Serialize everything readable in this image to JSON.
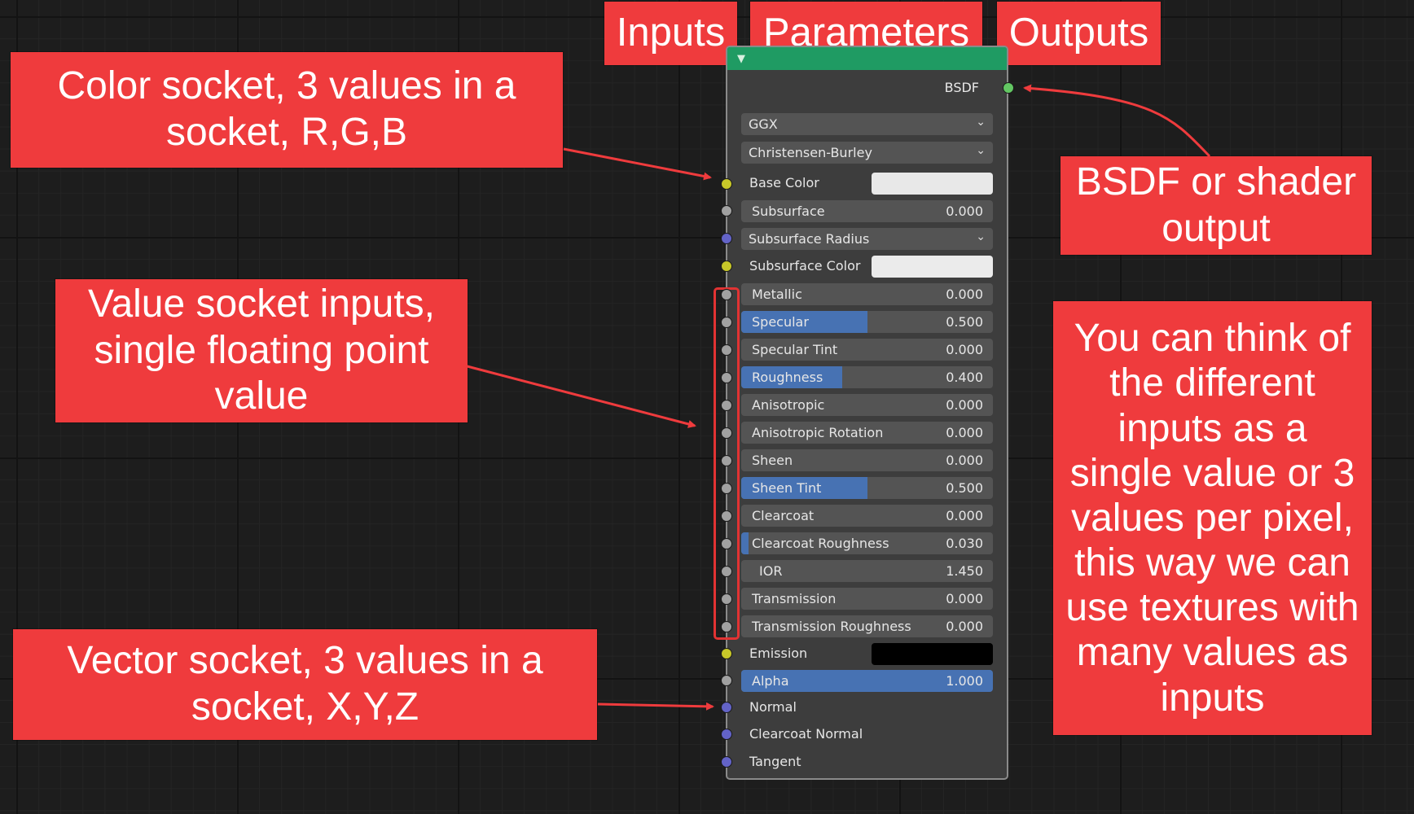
{
  "callouts": {
    "inputs": "Inputs",
    "parameters": "Parameters",
    "outputs": "Outputs",
    "color_socket": "Color socket, 3 values in a\nsocket, R,G,B",
    "bsdf_output": "BSDF or shader\noutput",
    "value_socket": "Value socket inputs,\nsingle floating point\nvalue",
    "textures_note": "You can think of\nthe different\ninputs as a\nsingle value or 3\nvalues per pixel,\nthis way we can\nuse textures with\nmany values as\ninputs",
    "vector_socket": "Vector socket, 3 values in a\nsocket, X,Y,Z"
  },
  "node": {
    "output_label": "BSDF",
    "distribution": "GGX",
    "subsurface_method": "Christensen-Burley",
    "base_color_label": "Base Color",
    "base_color": "#e8e8e8",
    "subsurface_radius_label": "Subsurface Radius",
    "subsurface_color_label": "Subsurface Color",
    "subsurface_color": "#ebebeb",
    "emission_label": "Emission",
    "emission_color": "#000000",
    "fields": [
      {
        "label": "Subsurface",
        "value": "0.000",
        "fill": 0.0
      },
      {
        "label": "Metallic",
        "value": "0.000",
        "fill": 0.0
      },
      {
        "label": "Specular",
        "value": "0.500",
        "fill": 0.5
      },
      {
        "label": "Specular Tint",
        "value": "0.000",
        "fill": 0.0
      },
      {
        "label": "Roughness",
        "value": "0.400",
        "fill": 0.4
      },
      {
        "label": "Anisotropic",
        "value": "0.000",
        "fill": 0.0
      },
      {
        "label": "Anisotropic Rotation",
        "value": "0.000",
        "fill": 0.0
      },
      {
        "label": "Sheen",
        "value": "0.000",
        "fill": 0.0
      },
      {
        "label": "Sheen Tint",
        "value": "0.500",
        "fill": 0.5
      },
      {
        "label": "Clearcoat",
        "value": "0.000",
        "fill": 0.0
      },
      {
        "label": "Clearcoat Roughness",
        "value": "0.030",
        "fill": 0.03
      },
      {
        "label": "IOR",
        "value": "1.450",
        "fill": 0.0
      },
      {
        "label": "Transmission",
        "value": "0.000",
        "fill": 0.0
      },
      {
        "label": "Transmission Roughness",
        "value": "0.000",
        "fill": 0.0
      },
      {
        "label": "Alpha",
        "value": "1.000",
        "fill": 1.0
      }
    ],
    "normal_label": "Normal",
    "clearcoat_normal_label": "Clearcoat Normal",
    "tangent_label": "Tangent"
  },
  "colors": {
    "callout_bg": "#ef3b3d",
    "node_header": "#1f9b63",
    "slider_fill": "#4772b3",
    "socket_color": "#c7c729",
    "socket_value": "#a1a1a1",
    "socket_vector": "#6363c7",
    "socket_shader": "#63c763"
  }
}
